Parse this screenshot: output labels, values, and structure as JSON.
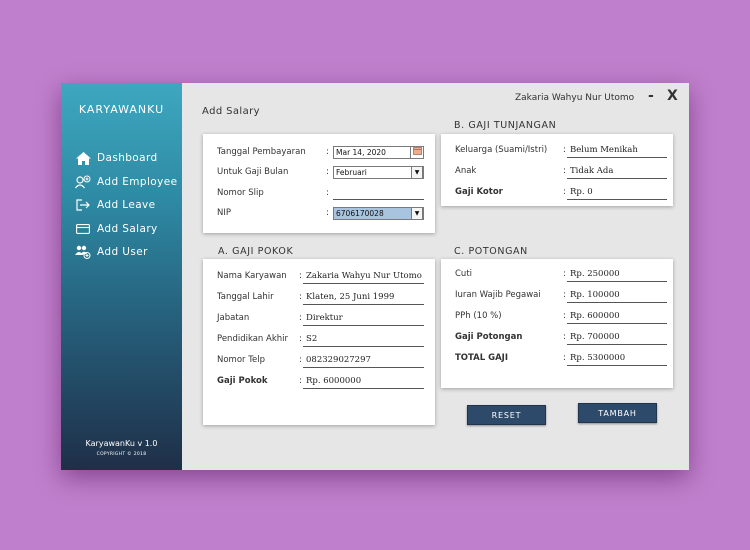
{
  "sidebar": {
    "brand": "KARYAWANKU",
    "items": [
      {
        "label": "Dashboard",
        "icon": "home-icon"
      },
      {
        "label": "Add Employee",
        "icon": "add-employee-icon"
      },
      {
        "label": "Add Leave",
        "icon": "leave-icon"
      },
      {
        "label": "Add Salary",
        "icon": "salary-icon"
      },
      {
        "label": "Add User",
        "icon": "add-user-icon"
      }
    ],
    "version": "KaryawanKu v 1.0",
    "copyright": "COPYRIGHT © 2018"
  },
  "header": {
    "page_title": "Add Salary",
    "user_name": "Zakaria Wahyu Nur Utomo",
    "minimize_label": "-",
    "close_label": "X"
  },
  "payment": {
    "tanggal_label": "Tanggal Pembayaran",
    "tanggal_value": "Mar 14, 2020",
    "bulan_label": "Untuk Gaji Bulan",
    "bulan_value": "Februari",
    "slip_label": "Nomor Slip",
    "slip_value": "",
    "nip_label": "NIP",
    "nip_value": "6706170028"
  },
  "gaji_pokok": {
    "title": "A. GAJI POKOK",
    "nama_label": "Nama Karyawan",
    "nama_value": "Zakaria Wahyu Nur Utomo",
    "lahir_label": "Tanggal Lahir",
    "lahir_value": "Klaten, 25 Juni 1999",
    "jabatan_label": "Jabatan",
    "jabatan_value": "Direktur",
    "pendidikan_label": "Pendidikan Akhir",
    "pendidikan_value": "S2",
    "telp_label": "Nomor Telp",
    "telp_value": "082329027297",
    "gaji_label": "Gaji Pokok",
    "gaji_value": "Rp. 6000000"
  },
  "tunjangan": {
    "title": "B. GAJI TUNJANGAN",
    "keluarga_label": "Keluarga (Suami/Istri)",
    "keluarga_value": "Belum Menikah",
    "anak_label": "Anak",
    "anak_value": "Tidak Ada",
    "kotor_label": "Gaji Kotor",
    "kotor_value": "Rp. 0"
  },
  "potongan": {
    "title": "C. POTONGAN",
    "cuti_label": "Cuti",
    "cuti_value": "Rp. 250000",
    "iuran_label": "Iuran Wajib Pegawai",
    "iuran_value": "Rp. 100000",
    "pph_label": "PPh (10 %)",
    "pph_value": "Rp. 600000",
    "gaji_potongan_label": "Gaji Potongan",
    "gaji_potongan_value": "Rp. 700000",
    "total_label": "TOTAL GAJI",
    "total_value": "Rp. 5300000"
  },
  "actions": {
    "reset_label": "RESET",
    "tambah_label": "TAMBAH"
  },
  "colon": ":"
}
